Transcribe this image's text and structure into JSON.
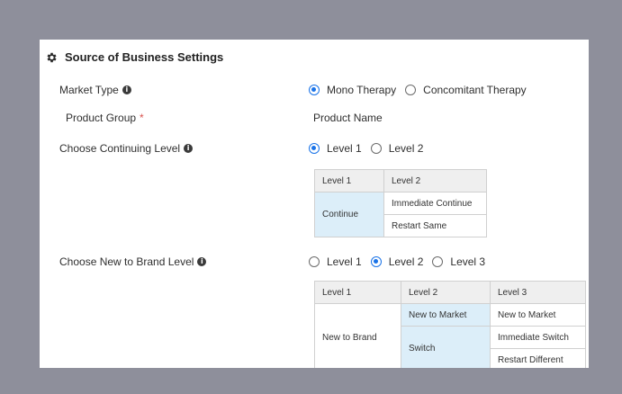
{
  "settings": {
    "title": "Source of Business Settings",
    "market_type": {
      "label": "Market Type",
      "options": [
        "Mono Therapy",
        "Concomitant Therapy"
      ],
      "selected": "Mono Therapy"
    },
    "product_group": {
      "label": "Product Group",
      "required_mark": "*",
      "value": "Product Name"
    },
    "continuing": {
      "label": "Choose Continuing Level",
      "options": [
        "Level 1",
        "Level 2"
      ],
      "selected": "Level 1",
      "table": {
        "headers": [
          "Level 1",
          "Level 2"
        ],
        "level1": "Continue",
        "level2": [
          "Immediate Continue",
          "Restart Same"
        ]
      }
    },
    "new_to_brand": {
      "label": "Choose New to Brand Level",
      "options": [
        "Level 1",
        "Level 2",
        "Level 3"
      ],
      "selected": "Level 2",
      "table": {
        "headers": [
          "Level 1",
          "Level 2",
          "Level 3"
        ],
        "level1": "New to Brand",
        "level2": [
          "New to Market",
          "Switch"
        ],
        "level3": [
          "New to Market",
          "Immediate Switch",
          "Restart Different"
        ]
      }
    }
  },
  "icons": {
    "title": "gear-icon",
    "info": "info-icon"
  },
  "colors": {
    "background": "#8e8f9b",
    "accent": "#1a73e8",
    "required": "#d9534f",
    "highlight_cell": "#dceef9",
    "header_cell": "#efefef"
  }
}
